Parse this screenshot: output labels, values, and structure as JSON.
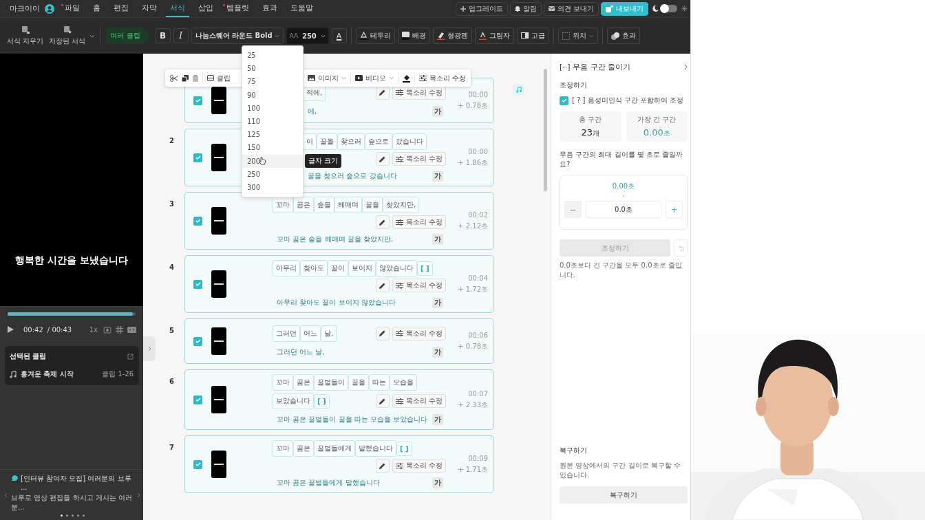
{
  "top_bar": {
    "user": "마크이이",
    "tabs": [
      {
        "label": "파일",
        "selected": false,
        "dot": true
      },
      {
        "label": "홈",
        "selected": false,
        "dot": false
      },
      {
        "label": "편집",
        "selected": false,
        "dot": false
      },
      {
        "label": "자막",
        "selected": false,
        "dot": false
      },
      {
        "label": "서식",
        "selected": true,
        "dot": false
      },
      {
        "label": "삽입",
        "selected": false,
        "dot": false
      },
      {
        "label": "템플릿",
        "selected": false,
        "dot": true
      },
      {
        "label": "효과",
        "selected": false,
        "dot": false
      },
      {
        "label": "도움말",
        "selected": false,
        "dot": false
      }
    ],
    "actions": [
      {
        "kind": "upgrade",
        "label": "업그레이드"
      },
      {
        "kind": "bell",
        "label": "알림"
      },
      {
        "kind": "mail",
        "label": "의견 보내기"
      },
      {
        "kind": "export",
        "label": "내보내기"
      }
    ],
    "theme_toggle": {
      "on": false
    }
  },
  "toolbar": {
    "format_buttons": [
      {
        "kind": "clear",
        "label": "서식 지우기"
      },
      {
        "kind": "saved",
        "label": "저장된 서식"
      }
    ],
    "scope_tag": "여러 클립",
    "bold": "B",
    "italic": "I",
    "font": "나눔스퀘어 라운드 Bold",
    "size_glyph": "AA",
    "size": "250",
    "color_letter": "A",
    "style_buttons": [
      {
        "kind": "border",
        "label": "테두리"
      },
      {
        "kind": "background",
        "label": "배경"
      },
      {
        "kind": "highlighter",
        "label": "형광펜"
      },
      {
        "kind": "shadow",
        "label": "그림자"
      },
      {
        "kind": "advanced",
        "label": "고급"
      }
    ],
    "position": "위치",
    "effects": "효과"
  },
  "player": {
    "caption": "행복한 시간을 보냈습니다",
    "level": 0.98,
    "time": "00:42",
    "duration": "/ 00:43",
    "speed": "1x"
  },
  "selected_clip": {
    "title": "선택된 클립",
    "track": "흥겨운 축제 시작",
    "range": "클립 1-26"
  },
  "notice": {
    "title": "[인터뷰 참여자 모집] 여러분의 브루 ...",
    "body": "브루로 영상 편집을 하시고 게시는 여러분...",
    "pages": [
      {
        "selected": true
      },
      {
        "selected": false
      },
      {
        "selected": false
      },
      {
        "selected": false
      },
      {
        "selected": false
      }
    ]
  },
  "float_toolbar": {
    "clip": "클립",
    "image": "이미지",
    "video": "비디오",
    "voice": "목소리 수정"
  },
  "size_menu": {
    "options": [
      {
        "label": "25",
        "selected": false
      },
      {
        "label": "50",
        "selected": false
      },
      {
        "label": "75",
        "selected": false
      },
      {
        "label": "90",
        "selected": false
      },
      {
        "label": "100",
        "selected": false
      },
      {
        "label": "110",
        "selected": false
      },
      {
        "label": "125",
        "selected": false
      },
      {
        "label": "150",
        "selected": false
      },
      {
        "label": "200",
        "selected": true
      },
      {
        "label": "250",
        "selected": false
      },
      {
        "label": "300",
        "selected": false
      }
    ],
    "tooltip": "글자 크기"
  },
  "clips": [
    {
      "cut": true,
      "checked": true,
      "chips": [
        {
          "kind": "word",
          "text": "적에,"
        }
      ],
      "time": "00:00",
      "length": "+ 0.78초",
      "sentence": "에,",
      "voice": "목소리 수정",
      "font_button": "가"
    },
    {
      "number": "2",
      "cut": true,
      "checked": true,
      "chips": [
        {
          "kind": "word",
          "text": "이"
        },
        {
          "kind": "word",
          "text": "꿀을"
        },
        {
          "kind": "word",
          "text": "찾으러"
        },
        {
          "kind": "word",
          "text": "숲으로"
        },
        {
          "kind": "word",
          "text": "갔습니다"
        }
      ],
      "time": "00:00",
      "length": "+ 1.86초",
      "sentence": "꿀을 찾으러 숲으로 갔습니다",
      "voice": "목소리 수정",
      "font_button": "가"
    },
    {
      "number": "3",
      "cut": false,
      "checked": true,
      "chips": [
        {
          "kind": "word",
          "text": "꼬마"
        },
        {
          "kind": "word",
          "text": "곰은"
        },
        {
          "kind": "word",
          "text": "숲을"
        },
        {
          "kind": "word",
          "text": "헤매며"
        },
        {
          "kind": "word",
          "text": "꿀을"
        },
        {
          "kind": "word",
          "text": "찾았지만,"
        }
      ],
      "time": "00:02",
      "length": "+ 2.12초",
      "sentence": "꼬마 곰은 숲을 헤매며 꿀을 찾았지만,",
      "voice": "목소리 수정",
      "font_button": "가"
    },
    {
      "number": "4",
      "cut": false,
      "checked": true,
      "chips": [
        {
          "kind": "word",
          "text": "아무리"
        },
        {
          "kind": "word",
          "text": "찾아도"
        },
        {
          "kind": "word",
          "text": "꿀이"
        },
        {
          "kind": "word",
          "text": "보이지"
        },
        {
          "kind": "word",
          "text": "않았습니다"
        },
        {
          "kind": "pause",
          "text": "[ ]"
        }
      ],
      "time": "00:04",
      "length": "+ 1.72초",
      "sentence": "아무리 찾아도 꿀이 보이지 않았습니다",
      "voice": "목소리 수정",
      "font_button": "가"
    },
    {
      "number": "5",
      "cut": false,
      "checked": true,
      "chips": [
        {
          "kind": "word",
          "text": "그러던"
        },
        {
          "kind": "word",
          "text": "어느"
        },
        {
          "kind": "word",
          "text": "날,"
        }
      ],
      "time": "00:06",
      "length": "+ 0.78초",
      "sentence": "그러던 어느 날,",
      "voice": "목소리 수정",
      "font_button": "가"
    },
    {
      "number": "6",
      "cut": false,
      "checked": true,
      "chips": [
        {
          "kind": "word",
          "text": "꼬마"
        },
        {
          "kind": "word",
          "text": "곰은"
        },
        {
          "kind": "word",
          "text": "꿀벌들이"
        },
        {
          "kind": "word",
          "text": "꿀을"
        },
        {
          "kind": "word",
          "text": "따는"
        },
        {
          "kind": "word",
          "text": "모습을"
        },
        {
          "kind": "word",
          "text": "보았습니다"
        },
        {
          "kind": "pause",
          "text": "[ ]"
        }
      ],
      "time": "00:07",
      "length": "+ 2.33초",
      "sentence": "꼬마 곰은 꿀벌들이 꿀을 따는 모습을 보았습니다",
      "voice": "목소리 수정",
      "font_button": "가"
    },
    {
      "number": "7",
      "cut": false,
      "checked": true,
      "chips": [
        {
          "kind": "word",
          "text": "꼬마"
        },
        {
          "kind": "word",
          "text": "곰은"
        },
        {
          "kind": "word",
          "text": "꿀벌들에게"
        },
        {
          "kind": "word",
          "text": "말했습니다"
        },
        {
          "kind": "pause",
          "text": "[ ]"
        }
      ],
      "time": "00:09",
      "length": "+ 1.71초",
      "sentence": "꼬마 곰은 꿀벌들에게 말했습니다",
      "voice": "목소리 수정",
      "font_button": "가"
    }
  ],
  "silence_panel": {
    "title": "[··] 무음 구간 줄이기",
    "section": "조정하기",
    "include_option": {
      "label": "[ ? ] 음성미인식 구간 포함하여 조정",
      "checked": true
    },
    "stats": [
      {
        "kind": "plain",
        "label": "총 구간",
        "value": "23",
        "unit": "개"
      },
      {
        "kind": "accent",
        "label": "가장 긴 구간",
        "value": "0.00",
        "unit": "초"
      }
    ],
    "question": "무음 구간의 최대 길이를 몇 초로 줄일까요?",
    "reading": "0.00초",
    "minus": "−",
    "input": "0.0초",
    "plus": "+",
    "apply_button": {
      "label": "조정하기",
      "disabled": true
    },
    "note": "0.0초보다 긴 구간을 모두 0.0초로 줄입니다.",
    "restore_title": "복구하기",
    "restore_note": "원본 영상에서의 구간 길이로 복구할 수 있습니다.",
    "restore_button": "복구하기"
  }
}
